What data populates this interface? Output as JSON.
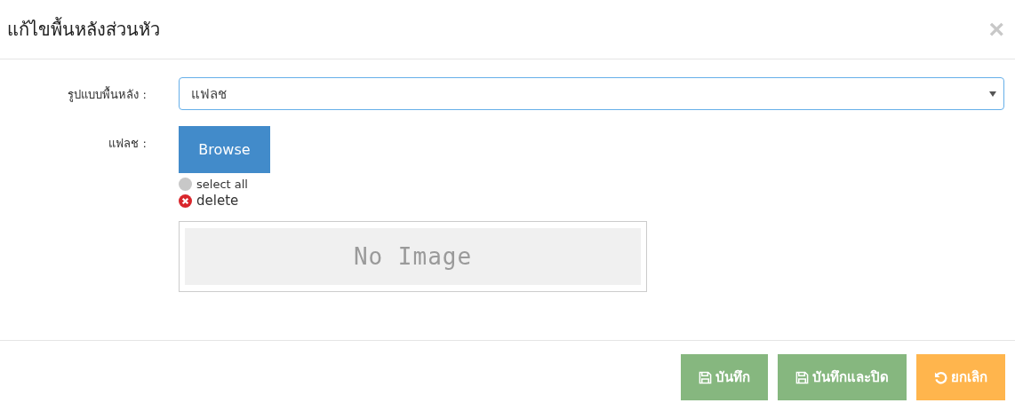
{
  "dialog": {
    "title": "แก้ไขพื้นหลังส่วนหัว",
    "close": "×"
  },
  "form": {
    "background_type": {
      "label": "รูปแบบพื้นหลัง :",
      "value": "แฟลช"
    },
    "flash": {
      "label": "แฟลช :",
      "browse": "Browse",
      "select_all": {
        "label": "select all",
        "selected": false
      },
      "delete": "delete",
      "preview": {
        "text": "No Image"
      }
    }
  },
  "buttons": [
    {
      "kind": "save",
      "label": "บันทึก"
    },
    {
      "kind": "save",
      "label": "บันทึกและปิด"
    },
    {
      "kind": "cancel",
      "label": "ยกเลิก"
    }
  ]
}
